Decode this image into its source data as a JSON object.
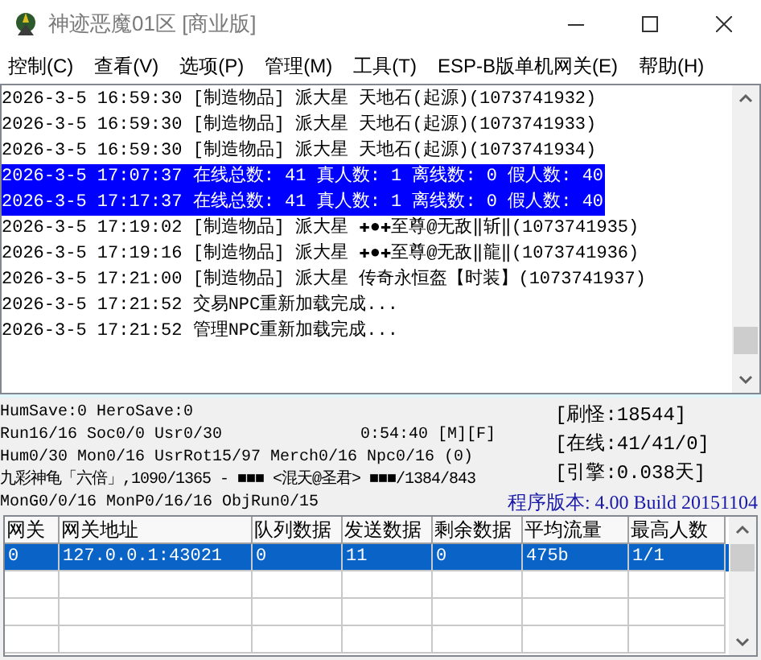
{
  "window": {
    "title": "神迹恶魔01区 [商业版]"
  },
  "menu": [
    "控制(C)",
    "查看(V)",
    "选项(P)",
    "管理(M)",
    "工具(T)",
    "ESP-B版单机网关(E)",
    "帮助(H)"
  ],
  "log": [
    {
      "text": "2026-3-5 16:59:30 [制造物品] 派大星 天地石(起源)(1073741932)",
      "selected": false
    },
    {
      "text": "2026-3-5 16:59:30 [制造物品] 派大星 天地石(起源)(1073741933)",
      "selected": false
    },
    {
      "text": "2026-3-5 16:59:30 [制造物品] 派大星 天地石(起源)(1073741934)",
      "selected": false
    },
    {
      "text": "2026-3-5 17:07:37 在线总数: 41 真人数: 1 离线数: 0 假人数: 40",
      "selected": true
    },
    {
      "text": "2026-3-5 17:17:37 在线总数: 41 真人数: 1 离线数: 0 假人数: 40",
      "selected": true
    },
    {
      "text": "2026-3-5 17:19:02 [制造物品] 派大星 ✚●✚至尊@无敌‖斩‖(1073741935)",
      "selected": false
    },
    {
      "text": "2026-3-5 17:19:16 [制造物品] 派大星 ✚●✚至尊@无敌‖龍‖(1073741936)",
      "selected": false
    },
    {
      "text": "2026-3-5 17:21:00 [制造物品] 派大星 传奇永恒盔【时装】(1073741937)",
      "selected": false
    },
    {
      "text": "2026-3-5 17:21:52 交易NPC重新加载完成...",
      "selected": false
    },
    {
      "text": "2026-3-5 17:21:52 管理NPC重新加载完成...",
      "selected": false
    }
  ],
  "status": {
    "lines": [
      "HumSave:0 HeroSave:0",
      "Run16/16 Soc0/0 Usr0/30",
      "Hum0/30 Mon0/16 UsrRot15/97 Merch0/16 Npc0/16 (0)",
      "九彩神龟「六倍」,1090/1365 - ■■■ <混天@圣君> ■■■/1384/843",
      "MonG0/0/16 MonP0/16/16 ObjRun0/15"
    ],
    "timer": "0:54:40 [M][F]",
    "counters": [
      "[刷怪:18544]",
      "[在线:41/41/0]",
      "[引擎:0.038天]"
    ],
    "version": "程序版本: 4.00 Build 20151104"
  },
  "table": {
    "columns": [
      "网关",
      "网关地址",
      "队列数据",
      "发送数据",
      "剩余数据",
      "平均流量",
      "最高人数"
    ],
    "rows": [
      {
        "cells": [
          "0",
          "127.0.0.1:43021",
          "0",
          "11",
          "0",
          "475b",
          "1/1"
        ],
        "selected": true
      }
    ]
  }
}
